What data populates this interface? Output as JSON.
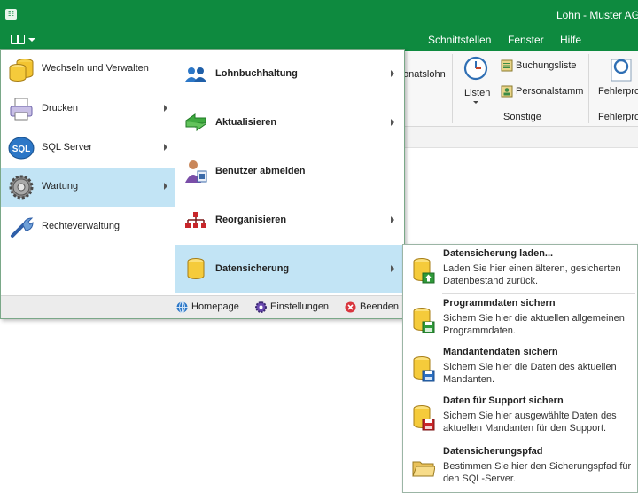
{
  "window": {
    "title": "Lohn - Muster AG",
    "app_icon_text": "☷"
  },
  "ribbon_tabs": [
    "Schnittstellen",
    "Fenster",
    "Hilfe"
  ],
  "ribbon": {
    "partial_monatslohn": "onatslohn",
    "listen": "Listen",
    "buchungsliste": "Buchungsliste",
    "personalstamm": "Personalstamm",
    "sonstige_group": "Sonstige",
    "fehlerpro_button": "Fehlerpro",
    "fehlerpro_group": "Fehlerpro"
  },
  "menu": {
    "left_items": [
      {
        "label": "Wechseln und Verwalten",
        "icon": "database-stack-icon",
        "has_submenu": false,
        "active": false
      },
      {
        "label": "Drucken",
        "icon": "printer-icon",
        "has_submenu": true,
        "active": false
      },
      {
        "label": "SQL Server",
        "icon": "sql-server-icon",
        "has_submenu": true,
        "active": false
      },
      {
        "label": "Wartung",
        "icon": "gear-icon",
        "has_submenu": true,
        "active": true
      },
      {
        "label": "Rechteverwaltung",
        "icon": "wrench-icon",
        "has_submenu": false,
        "active": false
      }
    ],
    "sub_items": [
      {
        "label": "Lohnbuchhaltung",
        "icon": "users-icon",
        "has_submenu": true,
        "active": false
      },
      {
        "label": "Aktualisieren",
        "icon": "refresh-icon",
        "has_submenu": true,
        "active": false
      },
      {
        "label": "Benutzer abmelden",
        "icon": "user-logout-icon",
        "has_submenu": false,
        "active": false
      },
      {
        "label": "Reorganisieren",
        "icon": "hierarchy-icon",
        "has_submenu": true,
        "active": false
      },
      {
        "label": "Datensicherung",
        "icon": "database-icon",
        "has_submenu": true,
        "active": true
      }
    ],
    "footer": {
      "homepage": "Homepage",
      "einstellungen": "Einstellungen",
      "beenden": "Beenden"
    }
  },
  "flyout": [
    {
      "title": "Datensicherung laden...",
      "desc": "Laden Sie hier einen älteren, gesicherten Datenbestand zurück.",
      "icon": "database-upload-icon"
    },
    {
      "title": "Programmdaten sichern",
      "desc": "Sichern Sie hier die aktuellen allgemeinen Programmdaten.",
      "icon": "database-save-icon"
    },
    {
      "title": "Mandantendaten sichern",
      "desc": "Sichern Sie hier die Daten des aktuellen Mandanten.",
      "icon": "database-save-icon"
    },
    {
      "title": "Daten für Support sichern",
      "desc": "Sichern Sie hier ausgewählte Daten des aktuellen Mandanten für den Support.",
      "icon": "database-save-icon"
    },
    {
      "title": "Datensicherungspfad",
      "desc": "Bestimmen Sie hier den Sicherungspfad für den SQL-Server.",
      "icon": "folder-icon"
    }
  ],
  "colors": {
    "accent_green": "#0e8a3f",
    "highlight_blue": "#c2e4f5"
  }
}
